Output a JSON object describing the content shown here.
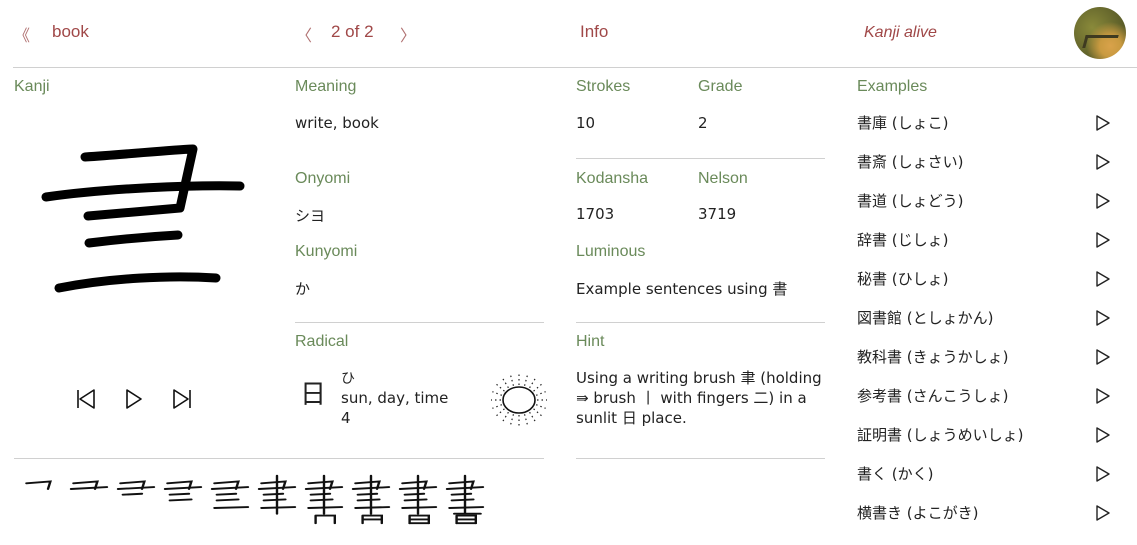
{
  "header": {
    "back_glyph": "《",
    "back_label": "book",
    "prev_glyph": "〈",
    "pager": "2 of 2",
    "next_glyph": "〉",
    "info_label": "Info",
    "brand": "Kanji alive"
  },
  "kanji_panel": {
    "label": "Kanji",
    "character": "書",
    "controls": [
      "skip-back",
      "play",
      "skip-forward"
    ],
    "stroke_count_shown": 10
  },
  "meaning": {
    "label": "Meaning",
    "value": "write, book"
  },
  "onyomi": {
    "label": "Onyomi",
    "value": "シヨ"
  },
  "kunyomi": {
    "label": "Kunyomi",
    "value": "か"
  },
  "radical": {
    "label": "Radical",
    "character": "日",
    "reading": "ひ",
    "meaning": "sun, day, time",
    "strokes": "4"
  },
  "info": {
    "strokes": {
      "label": "Strokes",
      "value": "10"
    },
    "grade": {
      "label": "Grade",
      "value": "2"
    },
    "kodansha": {
      "label": "Kodansha",
      "value": "1703"
    },
    "nelson": {
      "label": "Nelson",
      "value": "3719"
    },
    "luminous": {
      "label": "Luminous",
      "value": "Example sentences using 書"
    },
    "hint": {
      "label": "Hint",
      "value": "Using a writing brush 聿 (holding ⇛ brush 丨 with fingers 二) in a sunlit 日 place."
    }
  },
  "examples": {
    "label": "Examples",
    "items": [
      "書庫 (しょこ)",
      "書斎 (しょさい)",
      "書道 (しょどう)",
      "辞書 (じしょ)",
      "秘書 (ひしょ)",
      "図書館 (としょかん)",
      "教科書 (きょうかしょ)",
      "参考書 (さんこうしょ)",
      "証明書 (しょうめいしょ)",
      "書く (かく)",
      "横書き (よこがき)"
    ]
  },
  "colors": {
    "accent": "#a04848",
    "label_green": "#6a8a5a",
    "divider": "#d0d0d0"
  }
}
